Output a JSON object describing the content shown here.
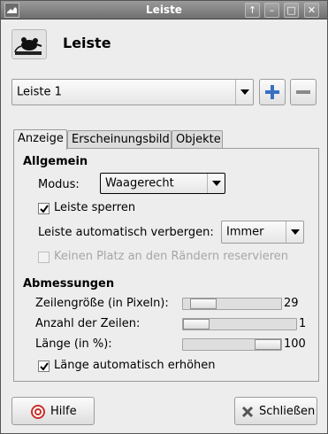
{
  "window": {
    "title": "Leiste"
  },
  "header": {
    "name": "Leiste"
  },
  "panel_select": {
    "value": "Leiste 1"
  },
  "tabs": [
    {
      "label": "Anzeige"
    },
    {
      "label": "Erscheinungsbild"
    },
    {
      "label": "Objekte"
    }
  ],
  "general": {
    "heading": "Allgemein",
    "mode_label": "Modus:",
    "mode_value": "Waagerecht",
    "lock_label": "Leiste sperren",
    "lock_checked": true,
    "autohide_label": "Leiste automatisch verbergen:",
    "autohide_value": "Immer",
    "reserve_label": "Keinen Platz an den Rändern reservieren",
    "reserve_checked": false
  },
  "dimensions": {
    "heading": "Abmessungen",
    "row_size_label": "Zeilengröße (in Pixeln):",
    "row_size_value": "29",
    "row_count_label": "Anzahl der Zeilen:",
    "row_count_value": "1",
    "length_label": "Länge (in %):",
    "length_value": "100",
    "auto_length_label": "Länge automatisch erhöhen",
    "auto_length_checked": true
  },
  "buttons": {
    "help": "Hilfe",
    "close": "Schließen"
  },
  "colors": {
    "titlebar": "#7f7f7f",
    "accent_blue": "#3a6fc4"
  }
}
